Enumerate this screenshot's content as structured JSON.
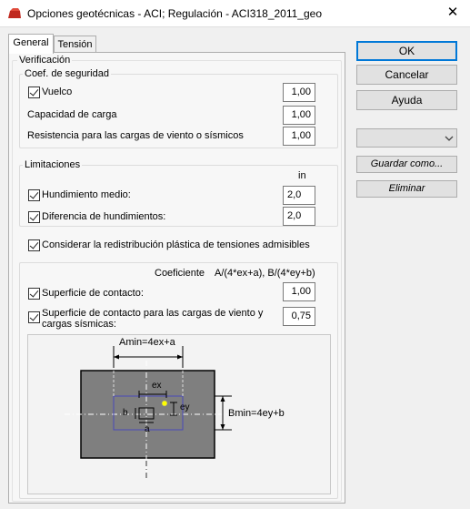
{
  "window": {
    "title": "Opciones geotécnicas - ACI;   Regulación - ACI318_2011_geo",
    "close_glyph": "✕"
  },
  "tabs": [
    {
      "label": "General"
    },
    {
      "label": "Tensión"
    }
  ],
  "verificacion": {
    "label": "Verificación",
    "coef": {
      "label": "Coef. de seguridad",
      "vuelco": {
        "label": "Vuelco",
        "checked": true,
        "value": "1,00"
      },
      "capacidad": {
        "label": "Capacidad de carga",
        "value": "1,00"
      },
      "resistencia": {
        "label": "Resistencia para las cargas de viento o sísmicos",
        "value": "1,00"
      }
    },
    "limitaciones": {
      "label": "Limitaciones",
      "unit": "in",
      "hundimiento": {
        "label": "Hundimiento medio:",
        "checked": true,
        "value": "2,0"
      },
      "diferencia": {
        "label": "Diferencia de hundimientos:",
        "checked": true,
        "value": "2,0"
      }
    },
    "redistribucion": {
      "label": "Considerar la redistribución plástica de tensiones admisibles",
      "checked": true
    },
    "contacto": {
      "coef_label": "Coeficiente",
      "formula": "A/(4*ex+a), B/(4*ey+b)",
      "superficie": {
        "label": "Superficie de contacto:",
        "checked": true,
        "value": "1,00"
      },
      "superficie_viento": {
        "label": "Superficie de contacto para las cargas de viento y cargas sísmicas:",
        "checked": true,
        "value": "0,75"
      }
    }
  },
  "diagram": {
    "amin_label": "Amin=4ex+a",
    "bmin_label": "Bmin=4ey+b",
    "ex": "ex",
    "ey": "ey",
    "a": "a",
    "b": "b"
  },
  "buttons": {
    "ok": "OK",
    "cancelar": "Cancelar",
    "ayuda": "Ayuda",
    "guardar": "Guardar como...",
    "eliminar": "Eliminar"
  },
  "colors": {
    "accent": "#0078d7",
    "footing": "#7f7f7f",
    "load_point": "#ffff00",
    "core": "#4a4ab8"
  }
}
